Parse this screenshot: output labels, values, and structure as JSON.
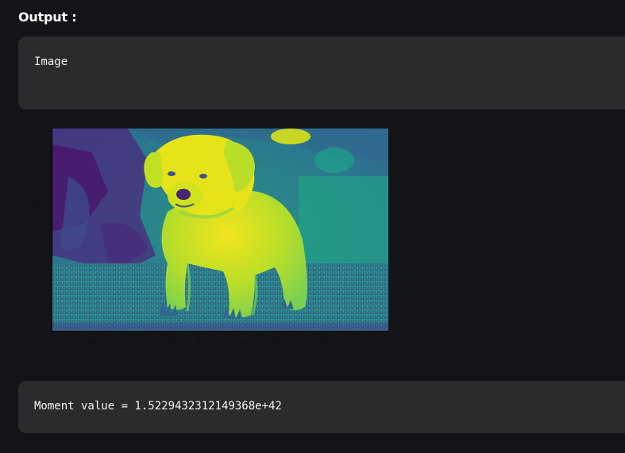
{
  "output": {
    "heading": "Output :"
  },
  "code_block_1": {
    "text": "Image"
  },
  "code_block_2": {
    "text": "Moment value = 1.5229432312149368e+42"
  },
  "plot": {
    "image_description_icon": "puppy-image",
    "colormap_colors": {
      "dark": "#440154",
      "purple": "#46327e",
      "blue": "#365c8d",
      "teal": "#277f8e",
      "green": "#1fa187",
      "lightgreen": "#4ac16d",
      "yellowgreen": "#a0da39",
      "yellow": "#fde725"
    },
    "y_ticks": [
      "0",
      "100",
      "200",
      "300",
      "400",
      "500"
    ],
    "x_ticks": [
      "0",
      "100",
      "200",
      "300",
      "400",
      "500",
      "600",
      "700",
      "800"
    ]
  }
}
